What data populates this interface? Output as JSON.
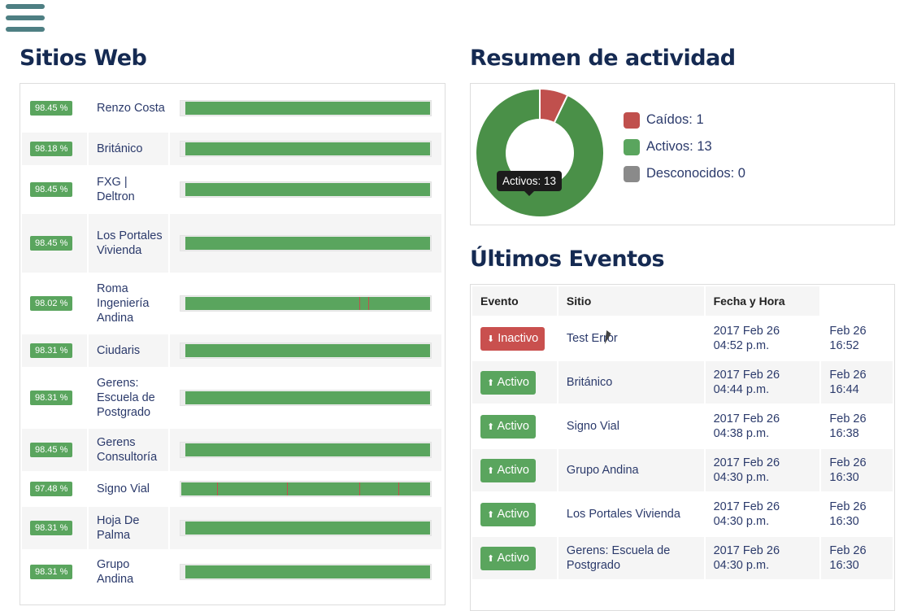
{
  "sites_title": "Sitios Web",
  "summary_title": "Resumen de actividad",
  "events_title": "Últimos Eventos",
  "sites": [
    {
      "pct": "98.45 %",
      "name": "Renzo Costa",
      "ticks": []
    },
    {
      "pct": "98.18 %",
      "name": "Británico",
      "ticks": []
    },
    {
      "pct": "98.45 %",
      "name": "FXG | Deltron",
      "ticks": []
    },
    {
      "pct": "98.45 %",
      "name": "Los Portales Vivienda",
      "ticks": []
    },
    {
      "pct": "98.02 %",
      "name": "Roma Ingeniería Andina",
      "ticks": [
        0.715,
        0.75
      ]
    },
    {
      "pct": "98.31 %",
      "name": "Ciudaris",
      "ticks": []
    },
    {
      "pct": "98.31 %",
      "name": "Gerens: Escuela de Postgrado",
      "ticks": []
    },
    {
      "pct": "98.45 %",
      "name": "Gerens Consultoría",
      "ticks": []
    },
    {
      "pct": "97.48 %",
      "name": "Signo Vial",
      "ticks": [
        0.145,
        0.425,
        0.715,
        0.87
      ]
    },
    {
      "pct": "98.31 %",
      "name": "Hoja De Palma",
      "ticks": []
    },
    {
      "pct": "98.31 %",
      "name": "Grupo Andina",
      "ticks": []
    }
  ],
  "summary": {
    "legend": [
      {
        "label": "Caídos: 1",
        "color": "#c0504d",
        "value": 1
      },
      {
        "label": "Activos: 13",
        "color": "#5aa55e",
        "value": 13
      },
      {
        "label": "Desconocidos: 0",
        "color": "#8a8a8a",
        "value": 0
      }
    ],
    "tooltip": "Activos: 13"
  },
  "events": {
    "headers": [
      "Evento",
      "Sitio",
      "Fecha y Hora"
    ],
    "rows": [
      {
        "state": "down",
        "label": "Inactivo",
        "site": "Test Error",
        "datetime": "2017 Feb 26 04:52 p.m.",
        "short": "Feb 26 16:52"
      },
      {
        "state": "up",
        "label": "Activo",
        "site": "Británico",
        "datetime": "2017 Feb 26 04:44 p.m.",
        "short": "Feb 26 16:44"
      },
      {
        "state": "up",
        "label": "Activo",
        "site": "Signo Vial",
        "datetime": "2017 Feb 26 04:38 p.m.",
        "short": "Feb 26 16:38"
      },
      {
        "state": "up",
        "label": "Activo",
        "site": "Grupo Andina",
        "datetime": "2017 Feb 26 04:30 p.m.",
        "short": "Feb 26 16:30"
      },
      {
        "state": "up",
        "label": "Activo",
        "site": "Los Portales Vivienda",
        "datetime": "2017 Feb 26 04:30 p.m.",
        "short": "Feb 26 16:30"
      },
      {
        "state": "up",
        "label": "Activo",
        "site": "Gerens: Escuela de Postgrado",
        "datetime": "2017 Feb 26 04:30 p.m.",
        "short": "Feb 26 16:30"
      }
    ]
  }
}
